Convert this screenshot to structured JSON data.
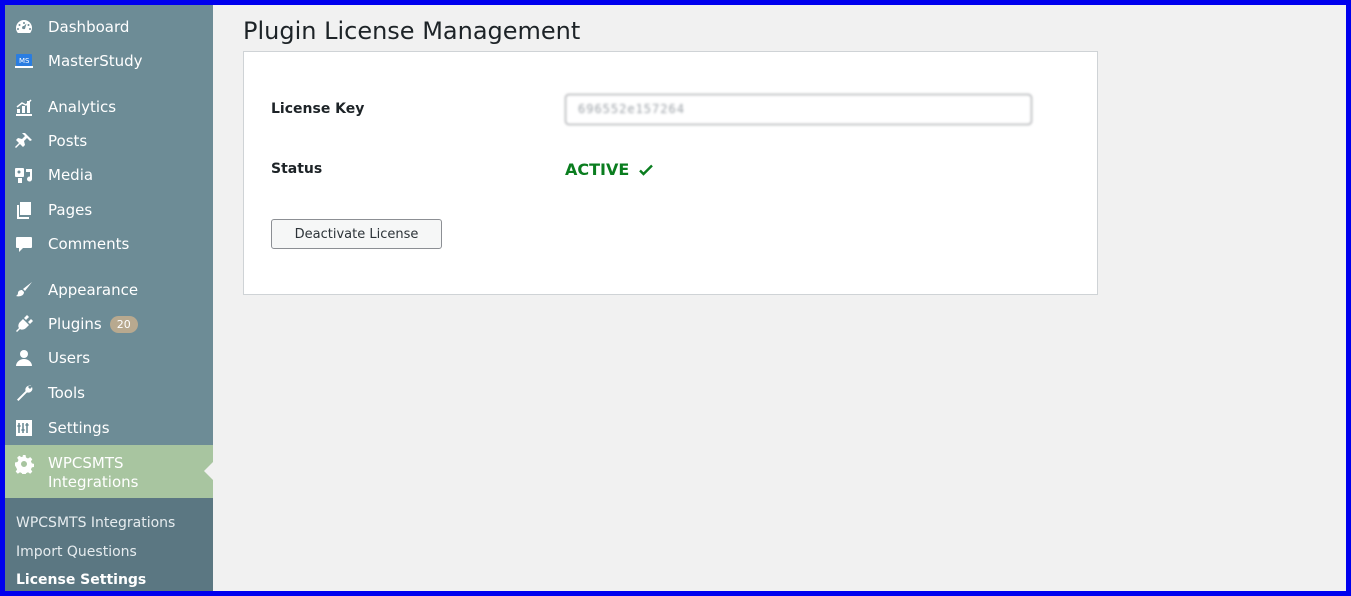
{
  "page": {
    "title": "Plugin License Management"
  },
  "sidebar": {
    "items": [
      {
        "label": "Dashboard",
        "icon": "dashboard-icon"
      },
      {
        "label": "MasterStudy",
        "icon": "masterstudy-icon"
      },
      {
        "label": "Analytics",
        "icon": "analytics-icon"
      },
      {
        "label": "Posts",
        "icon": "pin-icon"
      },
      {
        "label": "Media",
        "icon": "media-icon"
      },
      {
        "label": "Pages",
        "icon": "pages-icon"
      },
      {
        "label": "Comments",
        "icon": "comment-icon"
      },
      {
        "label": "Appearance",
        "icon": "brush-icon"
      },
      {
        "label": "Plugins",
        "icon": "plug-icon",
        "badge": "20"
      },
      {
        "label": "Users",
        "icon": "user-icon"
      },
      {
        "label": "Tools",
        "icon": "wrench-icon"
      },
      {
        "label": "Settings",
        "icon": "settings-sliders-icon"
      }
    ],
    "active": {
      "label_line1": "WPCSMTS",
      "label_line2": "Integrations",
      "icon": "gear-icon"
    },
    "submenu": [
      {
        "label": "WPCSMTS Integrations"
      },
      {
        "label": "Import Questions"
      },
      {
        "label": "License Settings"
      }
    ]
  },
  "license": {
    "key_label": "License Key",
    "key_value": "696552e157264",
    "status_label": "Status",
    "status_value": "ACTIVE",
    "status_color": "#0a7d1f",
    "deactivate_label": "Deactivate License"
  },
  "colors": {
    "sidebar_bg": "#6d8c96",
    "active_item_bg": "#a8c5a0",
    "submenu_bg": "#5b7782",
    "frame_border": "#0000ee"
  }
}
